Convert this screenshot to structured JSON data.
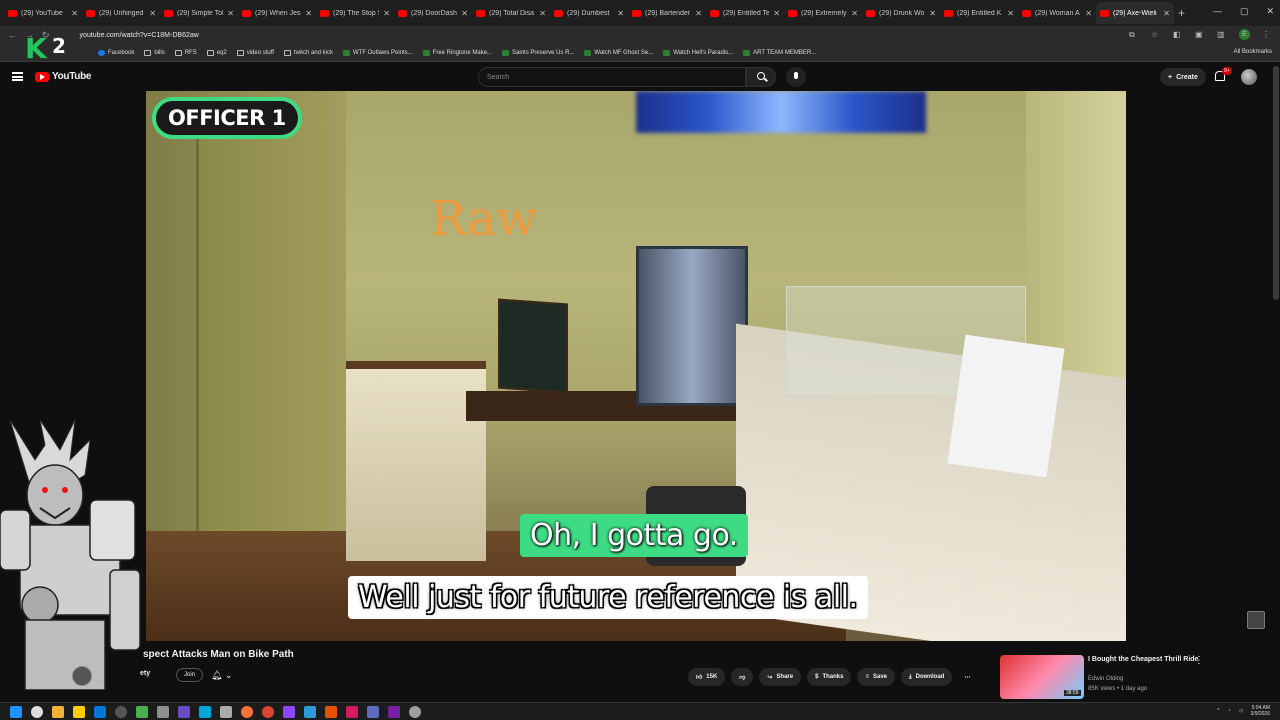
{
  "browser": {
    "tabs": [
      {
        "title": "(29) YouTube",
        "active": false
      },
      {
        "title": "(29) Unhinged",
        "active": false
      },
      {
        "title": "(29) Simple Tol",
        "active": false
      },
      {
        "title": "(29) When Jesi",
        "active": false
      },
      {
        "title": "(29) The Stop S",
        "active": false
      },
      {
        "title": "(29) DoorDash",
        "active": false
      },
      {
        "title": "(29) Total Disa",
        "active": false
      },
      {
        "title": "(29) Dumbest",
        "active": false
      },
      {
        "title": "(29) Bartender",
        "active": false
      },
      {
        "title": "(29) Entitled Te",
        "active": false
      },
      {
        "title": "(29) Extremely",
        "active": false
      },
      {
        "title": "(29) Drunk Wo",
        "active": false
      },
      {
        "title": "(29) Entitled K",
        "active": false
      },
      {
        "title": "(29) Woman A",
        "active": false
      },
      {
        "title": "(29) Axe-Wieli",
        "active": true
      }
    ],
    "url": "youtube.com/watch?v=C18M-DB62aw",
    "bookmarks": [
      {
        "label": "Facebook",
        "icon": "facebook-icon"
      },
      {
        "label": "bills",
        "icon": "folder-icon"
      },
      {
        "label": "RFS",
        "icon": "folder-icon"
      },
      {
        "label": "eq2",
        "icon": "folder-icon"
      },
      {
        "label": "video stuff",
        "icon": "folder-icon"
      },
      {
        "label": "twitch and kick",
        "icon": "folder-icon"
      },
      {
        "label": "WTF Outlaws Points...",
        "icon": "site-icon"
      },
      {
        "label": "Free Ringtone Make...",
        "icon": "site-icon"
      },
      {
        "label": "Saints Preserve Us R...",
        "icon": "site-icon"
      },
      {
        "label": "Watch MF Ghost Se...",
        "icon": "site-icon"
      },
      {
        "label": "Watch Hell's Paradis...",
        "icon": "site-icon"
      },
      {
        "label": "ART TEAM MEMBER...",
        "icon": "site-icon"
      }
    ],
    "all_bookmarks": "All Bookmarks",
    "profile_initial": "E"
  },
  "youtube": {
    "logo_text": "YouTube",
    "search_placeholder": "Search",
    "create_label": "Create",
    "notif_badge": "9+"
  },
  "video": {
    "officer_label": "OFFICER 1",
    "raw_label": "Raw",
    "caption_top": "Oh, I gotta go.",
    "caption_bottom": "Well just for future reference is all.",
    "overlay_logo": {
      "letter": "K",
      "number": "2"
    }
  },
  "below": {
    "title": "spect Attacks Man on Bike Path",
    "channel_name": "ety",
    "channel_subs": "3.",
    "join_label": "Join",
    "like_count": "15K",
    "share_label": "Share",
    "thanks_label": "Thanks",
    "save_label": "Save",
    "download_label": "Download"
  },
  "recommendation": {
    "title": "I Bought the Cheapest Thrill Ride",
    "channel": "Edwin Olding",
    "meta": "85K views • 1 day ago",
    "duration": "38:59"
  },
  "taskbar": {
    "time": "5:04 AM",
    "date": "3/9/2026"
  },
  "colors": {
    "accent_green": "#3ddc84",
    "youtube_red": "#ff0000",
    "background": "#0f0f0f"
  }
}
